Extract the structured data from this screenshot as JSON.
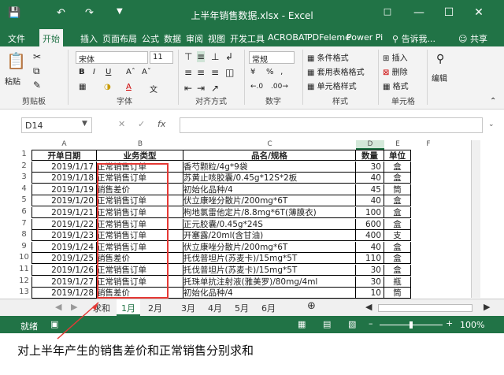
{
  "window": {
    "title": "上半年销售数据.xlsx - Excel"
  },
  "ribbon": {
    "tabs": [
      "文件",
      "开始",
      "插入",
      "页面布局",
      "公式",
      "数据",
      "审阅",
      "视图",
      "开发工具",
      "ACROBAT",
      "PDFeleme",
      "Power Pi"
    ],
    "tell_me": "告诉我...",
    "share": "共享",
    "paste": "粘贴",
    "clipboard": "剪贴板",
    "font_name": "宋体",
    "font_size": "11",
    "font_group": "字体",
    "align_group": "对齐方式",
    "number_format": "常规",
    "number_group": "数字",
    "cond_format": "条件格式",
    "table_format": "套用表格格式",
    "cell_style": "单元格样式",
    "styles_group": "样式",
    "insert": "插入",
    "delete": "删除",
    "format": "格式",
    "cells_group": "单元格",
    "edit": "编辑"
  },
  "formula_bar": {
    "name_box": "D14",
    "fx": "fx"
  },
  "sheet": {
    "columns": [
      "A",
      "B",
      "C",
      "D",
      "E",
      "F"
    ],
    "headers": [
      "开单日期",
      "业务类型",
      "品名/规格",
      "数量",
      "单位"
    ],
    "rows": [
      [
        "2019/1/17",
        "正常销售订单",
        "香芍颗粒/4g*9袋",
        "30",
        "盒"
      ],
      [
        "2019/1/18",
        "正常销售订单",
        "苏黄止咳胶囊/0.45g*12S*2板",
        "40",
        "盒"
      ],
      [
        "2019/1/19",
        "销售差价",
        "初始化品种/4",
        "45",
        "筒"
      ],
      [
        "2019/1/20",
        "正常销售订单",
        "伏立康唑分散片/200mg*6T",
        "40",
        "盒"
      ],
      [
        "2019/1/21",
        "正常销售订单",
        "枸地氯雷他定片/8.8mg*6T(薄膜衣)",
        "100",
        "盒"
      ],
      [
        "2019/1/22",
        "正常销售订单",
        "正元胶囊/0.45g*24S",
        "600",
        "盒"
      ],
      [
        "2019/1/23",
        "正常销售订单",
        "开塞露/20ml(含甘油)",
        "400",
        "支"
      ],
      [
        "2019/1/24",
        "正常销售订单",
        "伏立康唑分散片/200mg*6T",
        "40",
        "盒"
      ],
      [
        "2019/1/25",
        "销售差价",
        "托伐普坦片(苏麦卡)/15mg*5T",
        "110",
        "盒"
      ],
      [
        "2019/1/26",
        "正常销售订单",
        "托伐普坦片(苏麦卡)/15mg*5T",
        "30",
        "盒"
      ],
      [
        "2019/1/27",
        "正常销售订单",
        "托珠单抗注射液(雅美罗)/80mg/4ml",
        "30",
        "瓶"
      ],
      [
        "2019/1/28",
        "销售差价",
        "初始化品种/4",
        "10",
        "筒"
      ]
    ]
  },
  "sheet_tabs": [
    "求和",
    "1月",
    "2月",
    "3月",
    "4月",
    "5月",
    "6月"
  ],
  "status": {
    "ready": "就绪",
    "zoom": "100%"
  },
  "caption": "对上半年产生的销售差价和正常销售分别求和"
}
